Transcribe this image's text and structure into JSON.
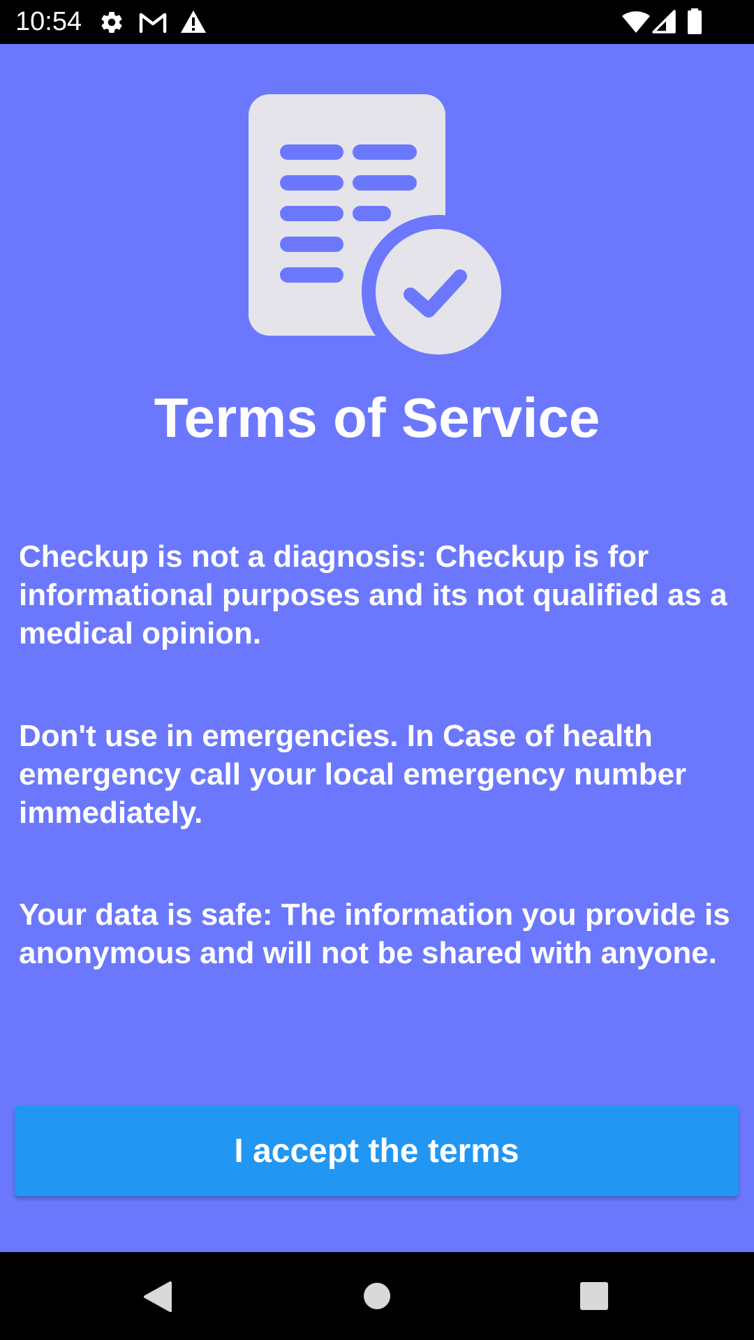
{
  "status_bar": {
    "time": "10:54",
    "icons_left": [
      "settings-icon",
      "gmail-icon",
      "warning-icon"
    ],
    "icons_right": [
      "wifi-icon",
      "cell-signal-icon",
      "battery-icon"
    ]
  },
  "main": {
    "icon": "document-check-icon",
    "title": "Terms of Service",
    "paragraphs": [
      "Checkup is not a diagnosis: Checkup is for informational purposes and its not qualified as a medical opinion.",
      "Don't use in emergencies. In Case of health emergency call your local emergency number immediately.",
      "Your data is safe: The information you provide is anonymous and will not be shared with anyone."
    ],
    "accept_button_label": "I accept the terms"
  },
  "nav_bar": {
    "buttons": [
      "back-icon",
      "home-icon",
      "recents-icon"
    ]
  },
  "colors": {
    "background": "#6b78fe",
    "button": "#2196f3",
    "icon_fill": "#e4e4ea",
    "system_bars": "#000000"
  }
}
